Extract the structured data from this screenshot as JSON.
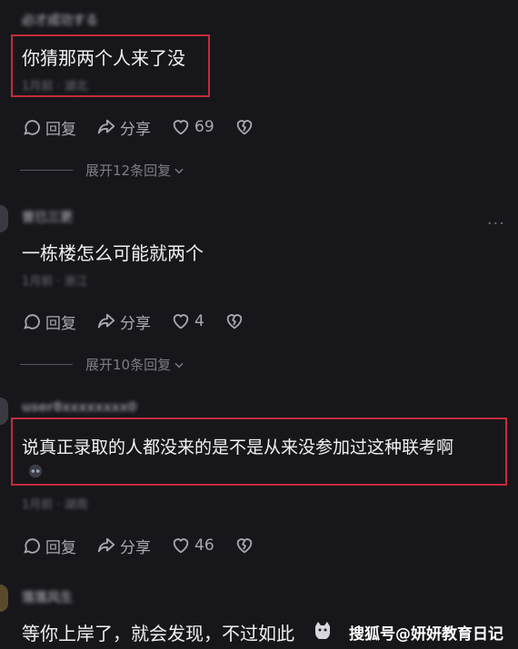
{
  "comments": [
    {
      "username": "必才成功する",
      "text": "你猜那两个人来了没",
      "meta": "1月前 · 湖北",
      "actions": {
        "reply": "回复",
        "share": "分享",
        "likes": "69"
      },
      "replies_label": "展开12条回复"
    },
    {
      "username": "曾已三更",
      "text": "一栋楼怎么可能就两个",
      "meta": "1月前 · 浙江",
      "actions": {
        "reply": "回复",
        "share": "分享",
        "likes": "4"
      },
      "replies_label": "展开10条回复"
    },
    {
      "username": "user8xxxxxxxx0",
      "text": "说真正录取的人都没来的是不是从来没参加过这种联考啊",
      "meta": "1月前 · 湖南",
      "actions": {
        "reply": "回复",
        "share": "分享",
        "likes": "46"
      }
    },
    {
      "username": "落落风生",
      "text": "等你上岸了，就会发现，不过如此"
    }
  ],
  "more_icon": "more-dots-icon",
  "watermark": "搜狐号@妍妍教育日记",
  "colors": {
    "highlight_box": "#c52b3c",
    "background": "#17171b"
  }
}
